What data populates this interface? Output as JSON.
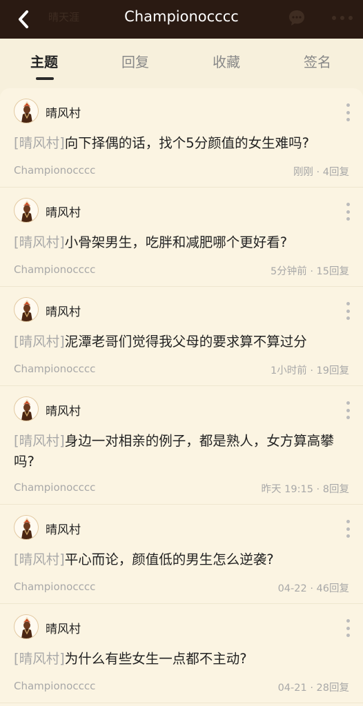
{
  "header": {
    "title": "Championocccc",
    "ghost_text": "晴天涯",
    "back_icon": "back-arrow-icon",
    "message_icon": "message-icon",
    "more_icon": "more-horizontal-icon"
  },
  "tabs": [
    {
      "label": "主题",
      "active": true
    },
    {
      "label": "回复",
      "active": false
    },
    {
      "label": "收藏",
      "active": false
    },
    {
      "label": "签名",
      "active": false
    }
  ],
  "posts": [
    {
      "author": "晴风村",
      "tag": "[晴风村]",
      "title": "向下择偶的话，找个5分颜值的女生难吗?",
      "username": "Championocccc",
      "time": "刚刚",
      "separator": "·",
      "replies": "4回复"
    },
    {
      "author": "晴风村",
      "tag": "[晴风村]",
      "title": "小骨架男生，吃胖和减肥哪个更好看?",
      "username": "Championocccc",
      "time": "5分钟前",
      "separator": "·",
      "replies": "15回复"
    },
    {
      "author": "晴风村",
      "tag": "[晴风村]",
      "title": "泥潭老哥们觉得我父母的要求算不算过分",
      "username": "Championocccc",
      "time": "1小时前",
      "separator": "·",
      "replies": "19回复"
    },
    {
      "author": "晴风村",
      "tag": "[晴风村]",
      "title": "身边一对相亲的例子，都是熟人，女方算高攀吗?",
      "username": "Championocccc",
      "time": "昨天 19:15",
      "separator": "·",
      "replies": "8回复"
    },
    {
      "author": "晴风村",
      "tag": "[晴风村]",
      "title": "平心而论，颜值低的男生怎么逆袭?",
      "username": "Championocccc",
      "time": "04-22",
      "separator": "·",
      "replies": "46回复"
    },
    {
      "author": "晴风村",
      "tag": "[晴风村]",
      "title": "为什么有些女生一点都不主动?",
      "username": "Championocccc",
      "time": "04-21",
      "separator": "·",
      "replies": "28回复"
    }
  ],
  "colors": {
    "topbar_bg": "#2a1a12",
    "page_bg": "#f7f0dc",
    "card_bg": "#fbf4e2",
    "muted_text": "#a8a8a8"
  }
}
